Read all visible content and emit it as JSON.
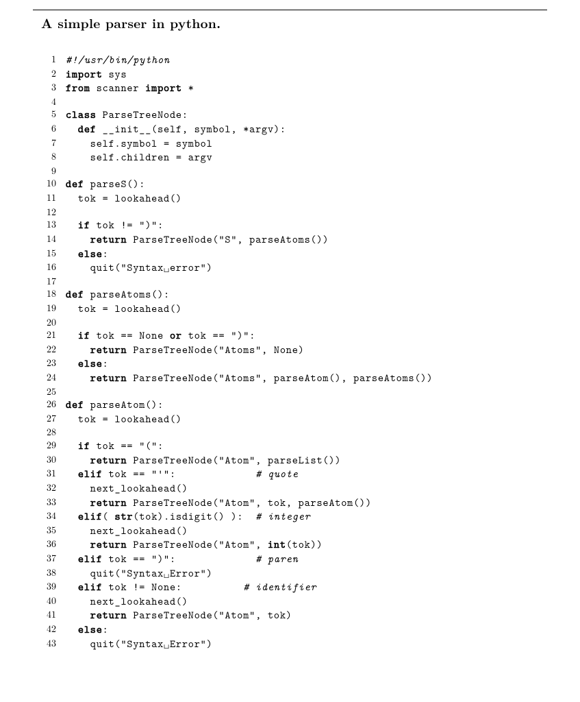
{
  "title": "A simple parser in python.",
  "code": {
    "lines": [
      {
        "n": 1,
        "tokens": [
          {
            "t": "#!/usr/bin/python",
            "c": "cm"
          }
        ]
      },
      {
        "n": 2,
        "tokens": [
          {
            "t": "import",
            "c": "kw"
          },
          {
            "t": " sys"
          }
        ]
      },
      {
        "n": 3,
        "tokens": [
          {
            "t": "from",
            "c": "kw"
          },
          {
            "t": " scanner "
          },
          {
            "t": "import",
            "c": "kw"
          },
          {
            "t": " *"
          }
        ]
      },
      {
        "n": 4,
        "tokens": [
          {
            "t": ""
          }
        ]
      },
      {
        "n": 5,
        "tokens": [
          {
            "t": "class",
            "c": "kw"
          },
          {
            "t": " ParseTreeNode:"
          }
        ]
      },
      {
        "n": 6,
        "tokens": [
          {
            "t": "  "
          },
          {
            "t": "def",
            "c": "kw"
          },
          {
            "t": " __init__(self, symbol, *argv):"
          }
        ]
      },
      {
        "n": 7,
        "tokens": [
          {
            "t": "    self.symbol = symbol"
          }
        ]
      },
      {
        "n": 8,
        "tokens": [
          {
            "t": "    self.children = argv"
          }
        ]
      },
      {
        "n": 9,
        "tokens": [
          {
            "t": ""
          }
        ]
      },
      {
        "n": 10,
        "tokens": [
          {
            "t": "def",
            "c": "kw"
          },
          {
            "t": " parseS():"
          }
        ]
      },
      {
        "n": 11,
        "tokens": [
          {
            "t": "  tok = lookahead()"
          }
        ]
      },
      {
        "n": 12,
        "tokens": [
          {
            "t": ""
          }
        ]
      },
      {
        "n": 13,
        "tokens": [
          {
            "t": "  "
          },
          {
            "t": "if",
            "c": "kw"
          },
          {
            "t": " tok != \")\":"
          }
        ]
      },
      {
        "n": 14,
        "tokens": [
          {
            "t": "    "
          },
          {
            "t": "return",
            "c": "kw"
          },
          {
            "t": " ParseTreeNode(\"S\", parseAtoms())"
          }
        ]
      },
      {
        "n": 15,
        "tokens": [
          {
            "t": "  "
          },
          {
            "t": "else",
            "c": "kw"
          },
          {
            "t": ":"
          }
        ]
      },
      {
        "n": 16,
        "tokens": [
          {
            "t": "    quit(\"Syntax␣error\")"
          }
        ]
      },
      {
        "n": 17,
        "tokens": [
          {
            "t": ""
          }
        ]
      },
      {
        "n": 18,
        "tokens": [
          {
            "t": "def",
            "c": "kw"
          },
          {
            "t": " parseAtoms():"
          }
        ]
      },
      {
        "n": 19,
        "tokens": [
          {
            "t": "  tok = lookahead()"
          }
        ]
      },
      {
        "n": 20,
        "tokens": [
          {
            "t": ""
          }
        ]
      },
      {
        "n": 21,
        "tokens": [
          {
            "t": "  "
          },
          {
            "t": "if",
            "c": "kw"
          },
          {
            "t": " tok == None "
          },
          {
            "t": "or",
            "c": "kw"
          },
          {
            "t": " tok == \")\":"
          }
        ]
      },
      {
        "n": 22,
        "tokens": [
          {
            "t": "    "
          },
          {
            "t": "return",
            "c": "kw"
          },
          {
            "t": " ParseTreeNode(\"Atoms\", None)"
          }
        ]
      },
      {
        "n": 23,
        "tokens": [
          {
            "t": "  "
          },
          {
            "t": "else",
            "c": "kw"
          },
          {
            "t": ":"
          }
        ]
      },
      {
        "n": 24,
        "tokens": [
          {
            "t": "    "
          },
          {
            "t": "return",
            "c": "kw"
          },
          {
            "t": " ParseTreeNode(\"Atoms\", parseAtom(), parseAtoms())"
          }
        ]
      },
      {
        "n": 25,
        "tokens": [
          {
            "t": ""
          }
        ]
      },
      {
        "n": 26,
        "tokens": [
          {
            "t": "def",
            "c": "kw"
          },
          {
            "t": " parseAtom():"
          }
        ]
      },
      {
        "n": 27,
        "tokens": [
          {
            "t": "  tok = lookahead()"
          }
        ]
      },
      {
        "n": 28,
        "tokens": [
          {
            "t": ""
          }
        ]
      },
      {
        "n": 29,
        "tokens": [
          {
            "t": "  "
          },
          {
            "t": "if",
            "c": "kw"
          },
          {
            "t": " tok == \"(\":"
          }
        ]
      },
      {
        "n": 30,
        "tokens": [
          {
            "t": "    "
          },
          {
            "t": "return",
            "c": "kw"
          },
          {
            "t": " ParseTreeNode(\"Atom\", parseList())"
          }
        ]
      },
      {
        "n": 31,
        "tokens": [
          {
            "t": "  "
          },
          {
            "t": "elif",
            "c": "kw"
          },
          {
            "t": " tok == \"'\":             "
          },
          {
            "t": "# quote",
            "c": "cm"
          }
        ]
      },
      {
        "n": 32,
        "tokens": [
          {
            "t": "    next_lookahead()"
          }
        ]
      },
      {
        "n": 33,
        "tokens": [
          {
            "t": "    "
          },
          {
            "t": "return",
            "c": "kw"
          },
          {
            "t": " ParseTreeNode(\"Atom\", tok, parseAtom())"
          }
        ]
      },
      {
        "n": 34,
        "tokens": [
          {
            "t": "  "
          },
          {
            "t": "elif",
            "c": "kw"
          },
          {
            "t": "( "
          },
          {
            "t": "str",
            "c": "kw"
          },
          {
            "t": "(tok).isdigit() ):  "
          },
          {
            "t": "# integer",
            "c": "cm"
          }
        ]
      },
      {
        "n": 35,
        "tokens": [
          {
            "t": "    next_lookahead()"
          }
        ]
      },
      {
        "n": 36,
        "tokens": [
          {
            "t": "    "
          },
          {
            "t": "return",
            "c": "kw"
          },
          {
            "t": " ParseTreeNode(\"Atom\", "
          },
          {
            "t": "int",
            "c": "kw"
          },
          {
            "t": "(tok))"
          }
        ]
      },
      {
        "n": 37,
        "tokens": [
          {
            "t": "  "
          },
          {
            "t": "elif",
            "c": "kw"
          },
          {
            "t": " tok == \")\":             "
          },
          {
            "t": "# paren",
            "c": "cm"
          }
        ]
      },
      {
        "n": 38,
        "tokens": [
          {
            "t": "    quit(\"Syntax␣Error\")"
          }
        ]
      },
      {
        "n": 39,
        "tokens": [
          {
            "t": "  "
          },
          {
            "t": "elif",
            "c": "kw"
          },
          {
            "t": " tok != None:          "
          },
          {
            "t": "# identifier",
            "c": "cm"
          }
        ]
      },
      {
        "n": 40,
        "tokens": [
          {
            "t": "    next_lookahead()"
          }
        ]
      },
      {
        "n": 41,
        "tokens": [
          {
            "t": "    "
          },
          {
            "t": "return",
            "c": "kw"
          },
          {
            "t": " ParseTreeNode(\"Atom\", tok)"
          }
        ]
      },
      {
        "n": 42,
        "tokens": [
          {
            "t": "  "
          },
          {
            "t": "else",
            "c": "kw"
          },
          {
            "t": ":"
          }
        ]
      },
      {
        "n": 43,
        "tokens": [
          {
            "t": "    quit(\"Syntax␣Error\")"
          }
        ]
      }
    ]
  }
}
